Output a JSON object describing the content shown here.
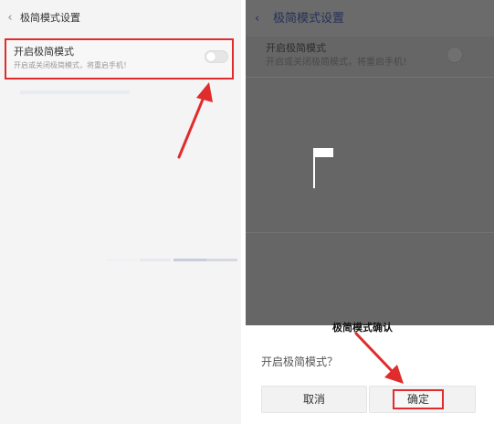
{
  "left": {
    "back_glyph": "‹",
    "title": "极简模式设置",
    "setting": {
      "title": "开启极简模式",
      "subtitle": "开启或关闭极简模式，将重启手机！",
      "toggle_on": false
    }
  },
  "right": {
    "back_glyph": "‹",
    "title": "极简模式设置",
    "setting": {
      "title": "开启极简模式",
      "subtitle": "开启或关闭极简模式，将重启手机！"
    },
    "dialog": {
      "title": "极简模式确认",
      "message": "开启极简模式？",
      "cancel_label": "取消",
      "confirm_label": "确定"
    }
  },
  "colors": {
    "highlight": "#e02c2c",
    "overlay": "#666666",
    "title_dark": "#27305a"
  }
}
